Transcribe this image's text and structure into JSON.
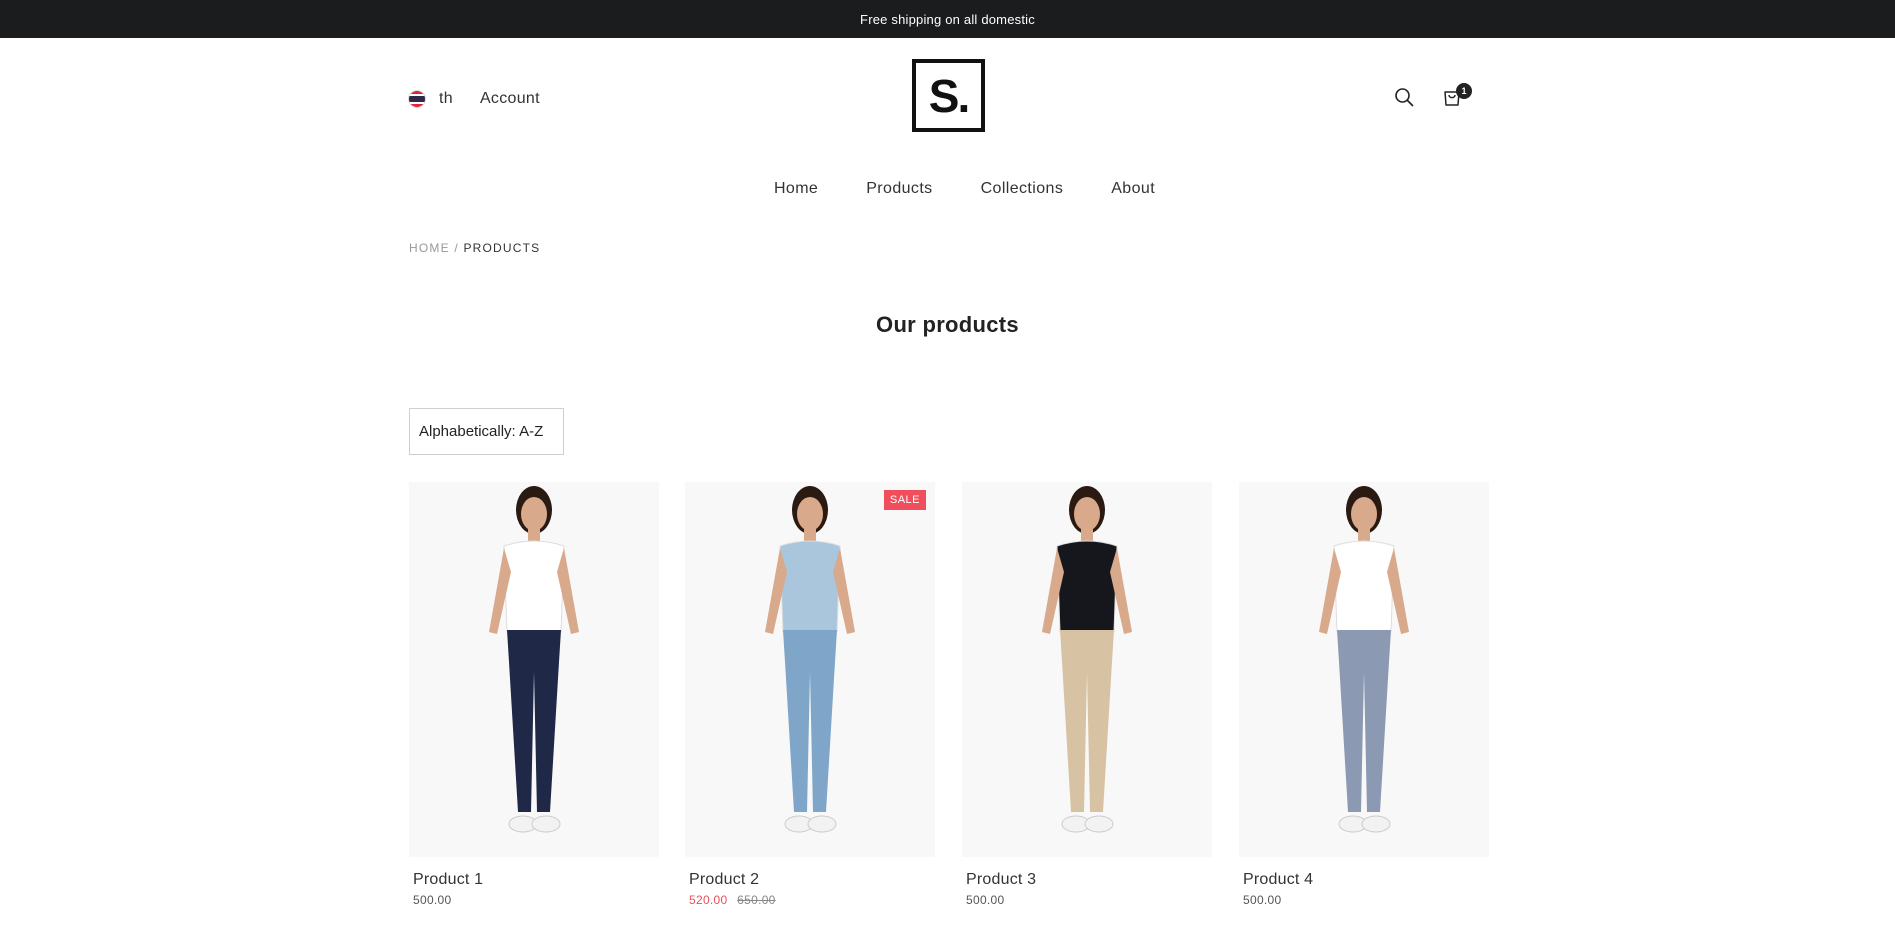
{
  "announcement": "Free shipping on all domestic",
  "header": {
    "language": "th",
    "account_label": "Account",
    "logo_text": "S.",
    "cart_count": "1"
  },
  "nav": {
    "items": [
      "Home",
      "Products",
      "Collections",
      "About"
    ]
  },
  "breadcrumb": {
    "home": "HOME",
    "separator": "/",
    "current": "PRODUCTS"
  },
  "page_title": "Our products",
  "sort": {
    "selected": "Alphabetically: A-Z"
  },
  "products": [
    {
      "name": "Product 1",
      "price": "500.00",
      "top_color": "#ffffff",
      "bottom_color": "#1f2846"
    },
    {
      "name": "Product 2",
      "sale_price": "520.00",
      "original_price": "650.00",
      "badge": "SALE",
      "top_color": "#a9c6dc",
      "bottom_color": "#7fa6c8"
    },
    {
      "name": "Product 3",
      "price": "500.00",
      "top_color": "#15171c",
      "bottom_color": "#d7c3a3"
    },
    {
      "name": "Product 4",
      "price": "500.00",
      "top_color": "#ffffff",
      "bottom_color": "#8b9ab2"
    }
  ],
  "colors": {
    "announcement_bg": "#1b1c1e",
    "sale_red": "#e8505b",
    "badge_bg": "#f04e5c"
  },
  "icons": {
    "search": "search-icon",
    "cart": "cart-icon",
    "flag": "thailand-flag-icon"
  }
}
